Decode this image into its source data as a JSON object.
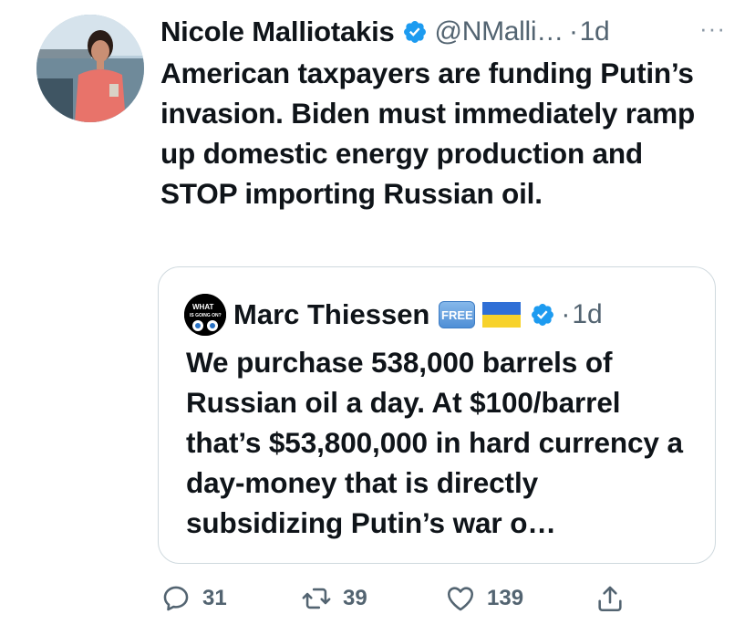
{
  "tweet": {
    "author_name": "Nicole Malliotakis",
    "handle": "@NMalli…",
    "separator": "·",
    "time": "1d",
    "more_label": "···",
    "text": "American taxpayers are funding Putin’s invasion. Biden must immediately ramp up domestic energy production and STOP importing Russian oil.",
    "verified_icon": "verified-badge-icon"
  },
  "quote": {
    "author_name": "Marc Thiessen",
    "badge_label": "FREE",
    "flag_icon": "ukraine-flag-icon",
    "separator": "·",
    "time": "1d",
    "avatar_text_top": "WHAT",
    "avatar_text_bottom": "IS GOING ON?",
    "text": "We purchase 538,000 barrels of Russian oil a day. At $100/barrel that’s $53,800,000 in hard currency a day-money that is directly subsidizing Putin’s war o…"
  },
  "actions": {
    "replies": "31",
    "retweets": "39",
    "likes": "139",
    "reply_icon": "reply-icon",
    "retweet_icon": "retweet-icon",
    "like_icon": "heart-icon",
    "share_icon": "share-icon"
  },
  "colors": {
    "verified_blue": "#1d9bf0",
    "secondary_text": "#536471",
    "border": "#cfd9de",
    "text": "#0f1419"
  }
}
